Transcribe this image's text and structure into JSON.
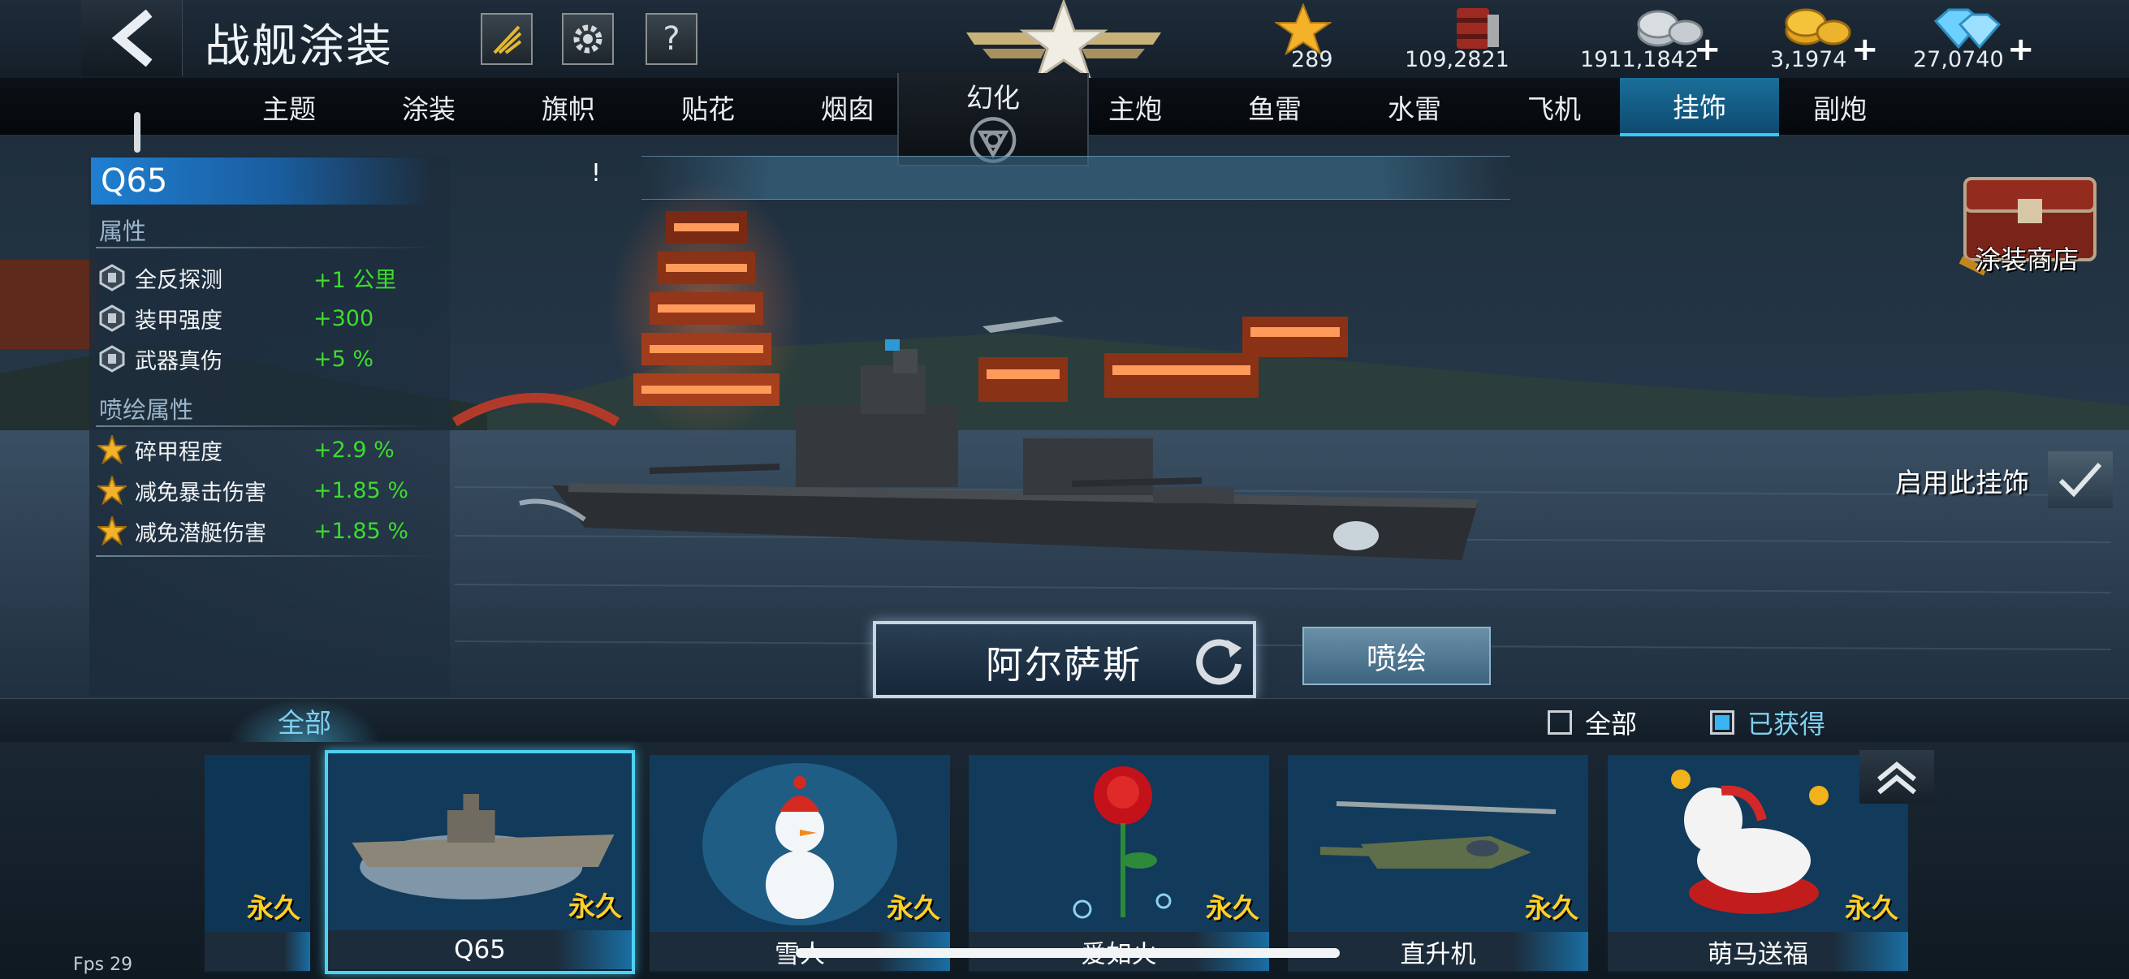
{
  "header": {
    "title": "战舰涂装",
    "help_label": "?"
  },
  "currencies": [
    {
      "name": "star",
      "value": "289",
      "has_plus": false
    },
    {
      "name": "oil-barrel",
      "value": "109,2821",
      "has_plus": false
    },
    {
      "name": "silver-coins",
      "value": "1911,1842",
      "has_plus": true
    },
    {
      "name": "gold-coins",
      "value": "3,1974",
      "has_plus": true
    },
    {
      "name": "diamonds",
      "value": "27,0740",
      "has_plus": true
    }
  ],
  "plus_sign": "+",
  "tabs": [
    "主题",
    "涂装",
    "旗帜",
    "贴花",
    "烟囱",
    "幻化",
    "主炮",
    "鱼雷",
    "水雷",
    "飞机",
    "挂饰",
    "副炮"
  ],
  "active_tab": "挂饰",
  "left_panel": {
    "skin_name": "Q65",
    "section_attributes": "属性",
    "attributes": [
      {
        "name": "全反探测",
        "value": "+1 公里"
      },
      {
        "name": "装甲强度",
        "value": "+300"
      },
      {
        "name": "武器真伤",
        "value": "+5 %"
      }
    ],
    "section_spray": "喷绘属性",
    "spray_attributes": [
      {
        "name": "碎甲程度",
        "value": "+2.9 %"
      },
      {
        "name": "减免暴击伤害",
        "value": "+1.85 %"
      },
      {
        "name": "减免潜艇伤害",
        "value": "+1.85 %"
      }
    ]
  },
  "banner_text": "!",
  "shop_label": "涂装商店",
  "enable_label": "启用此挂饰",
  "enable_checked": true,
  "ship_name": "阿尔萨斯",
  "spray_button": "喷绘",
  "filter": {
    "tab_label": "全部",
    "option_all": "全部",
    "option_all_checked": false,
    "option_owned": "已获得",
    "option_owned_checked": true
  },
  "items": [
    {
      "name": "",
      "tag": "永久",
      "icon": "partial-card",
      "selected": false
    },
    {
      "name": "Q65",
      "tag": "永久",
      "icon": "warship",
      "selected": true
    },
    {
      "name": "雪人",
      "tag": "永久",
      "icon": "snowman",
      "selected": false
    },
    {
      "name": "爱如火",
      "tag": "永久",
      "icon": "rose",
      "selected": false
    },
    {
      "name": "直升机",
      "tag": "永久",
      "icon": "helicopter",
      "selected": false
    },
    {
      "name": "萌马送福",
      "tag": "永久",
      "icon": "pony",
      "selected": false
    }
  ],
  "fps_label": "Fps 29",
  "colors": {
    "active_tab": "#1a6f9a",
    "attr_value": "#3ddc2e",
    "permanent_tag": "#ffcf26",
    "selected_border": "#4fd1f2"
  }
}
